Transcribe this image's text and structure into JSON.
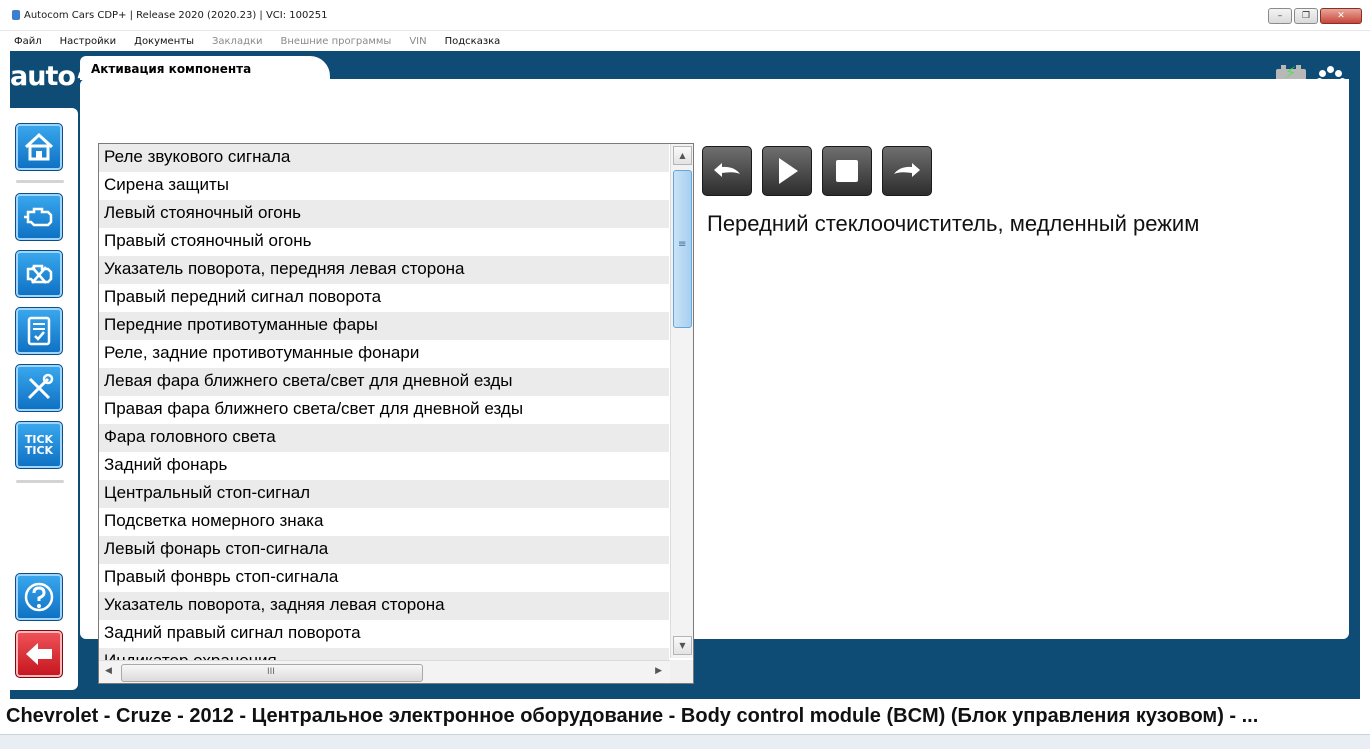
{
  "window": {
    "title": "Autocom Cars CDP+ | Release 2020 (2020.23)  |  VCI: 100251",
    "min_label": "–",
    "max_label": "❐",
    "close_label": "✕"
  },
  "menu": [
    {
      "label": "Файл",
      "enabled": true
    },
    {
      "label": "Настройки",
      "enabled": true
    },
    {
      "label": "Документы",
      "enabled": true
    },
    {
      "label": "Закладки",
      "enabled": false
    },
    {
      "label": "Внешние программы",
      "enabled": false
    },
    {
      "label": "VIN",
      "enabled": false
    },
    {
      "label": "Подсказка",
      "enabled": true
    }
  ],
  "header": {
    "logo": "auto∿com",
    "status_check": "✓",
    "battery_bolt": "⚡"
  },
  "sidebar": {
    "tick_line1": "TICK",
    "tick_line2": "TICK"
  },
  "tab": {
    "label": "Активация компонента"
  },
  "components": [
    "Реле звукового сигнала",
    "Сирена защиты",
    "Левый стояночный огонь",
    "Правый стояночный огонь",
    "Указатель поворота, передняя левая сторона",
    "Правый передний сигнал поворота",
    "Передние противотуманные фары",
    "Реле, задние противотуманные фонари",
    "Левая фара ближнего света/свет для дневной езды",
    "Правая фара ближнего света/свет для дневной езды",
    "Фара головного света",
    "Задний фонарь",
    "Центральный стоп-сигнал",
    "Подсветка номерного знака",
    "Левый фонарь стоп-сигнала",
    "Правый фонврь стоп-сигнала",
    "Указатель поворота, задняя левая сторона",
    "Задний правый сигнал поворота",
    "Индикатор охранения"
  ],
  "description": "Передний стеклоочиститель, медленный режим",
  "status": "Chevrolet - Cruze - 2012 - Центральное электронное оборудование - Body control module (BCM) (Блок управления кузовом) - ..."
}
